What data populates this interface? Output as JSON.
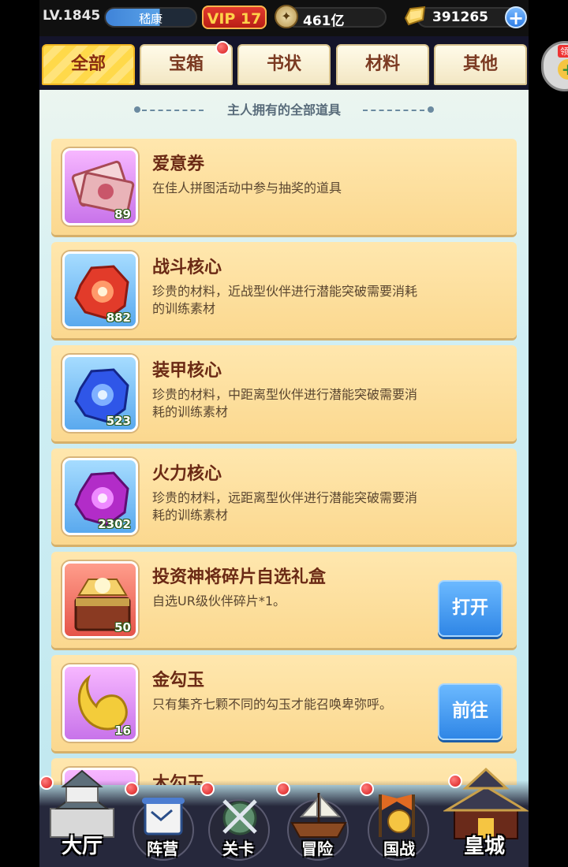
{
  "player": {
    "level": "LV.1845",
    "name": "嵇康",
    "vip": "VIP 17",
    "coins": "461亿",
    "gold": "391265"
  },
  "floating": {
    "tag": "领"
  },
  "tabs": [
    {
      "label": "全部",
      "active": true
    },
    {
      "label": "宝箱",
      "badge": true
    },
    {
      "label": "书状"
    },
    {
      "label": "材料"
    },
    {
      "label": "其他"
    }
  ],
  "subtitle": "主人拥有的全部道具",
  "items": [
    {
      "name": "爱意券",
      "desc": "在佳人拼图活动中参与抽奖的道具",
      "count": "89",
      "icon": "ticket-icon"
    },
    {
      "name": "战斗核心",
      "desc": "珍贵的材料，近战型伙伴进行潜能突破需要消耗的训练素材",
      "count": "882",
      "icon": "red-core-icon"
    },
    {
      "name": "装甲核心",
      "desc": "珍贵的材料，中距离型伙伴进行潜能突破需要消耗的训练素材",
      "count": "523",
      "icon": "blue-core-icon"
    },
    {
      "name": "火力核心",
      "desc": "珍贵的材料，远距离型伙伴进行潜能突破需要消耗的训练素材",
      "count": "2302",
      "icon": "purple-core-icon"
    },
    {
      "name": "投资神将碎片自选礼盒",
      "desc": "自选UR级伙伴碎片*1。",
      "count": "50",
      "icon": "treasure-chest-icon",
      "action": "打开"
    },
    {
      "name": "金勾玉",
      "desc": "只有集齐七颗不同的勾玉才能召唤卑弥呼。",
      "count": "16",
      "icon": "magatama-icon",
      "action": "前往"
    },
    {
      "name": "木勾玉",
      "desc": "",
      "count": "",
      "icon": "magatama-icon"
    }
  ],
  "nav": [
    {
      "label": "大厅",
      "icon": "castle-icon"
    },
    {
      "label": "阵营",
      "icon": "scroll-map-icon"
    },
    {
      "label": "关卡",
      "icon": "crossed-swords-icon"
    },
    {
      "label": "冒险",
      "icon": "ship-icon"
    },
    {
      "label": "国战",
      "icon": "war-flags-icon"
    },
    {
      "label": "皇城",
      "icon": "palace-icon"
    }
  ],
  "colors": {
    "accent_blue": "#2f86e6",
    "card_bg": "#fbd88f",
    "tab_active": "#ffd94a",
    "badge_red": "#d71c1c"
  }
}
